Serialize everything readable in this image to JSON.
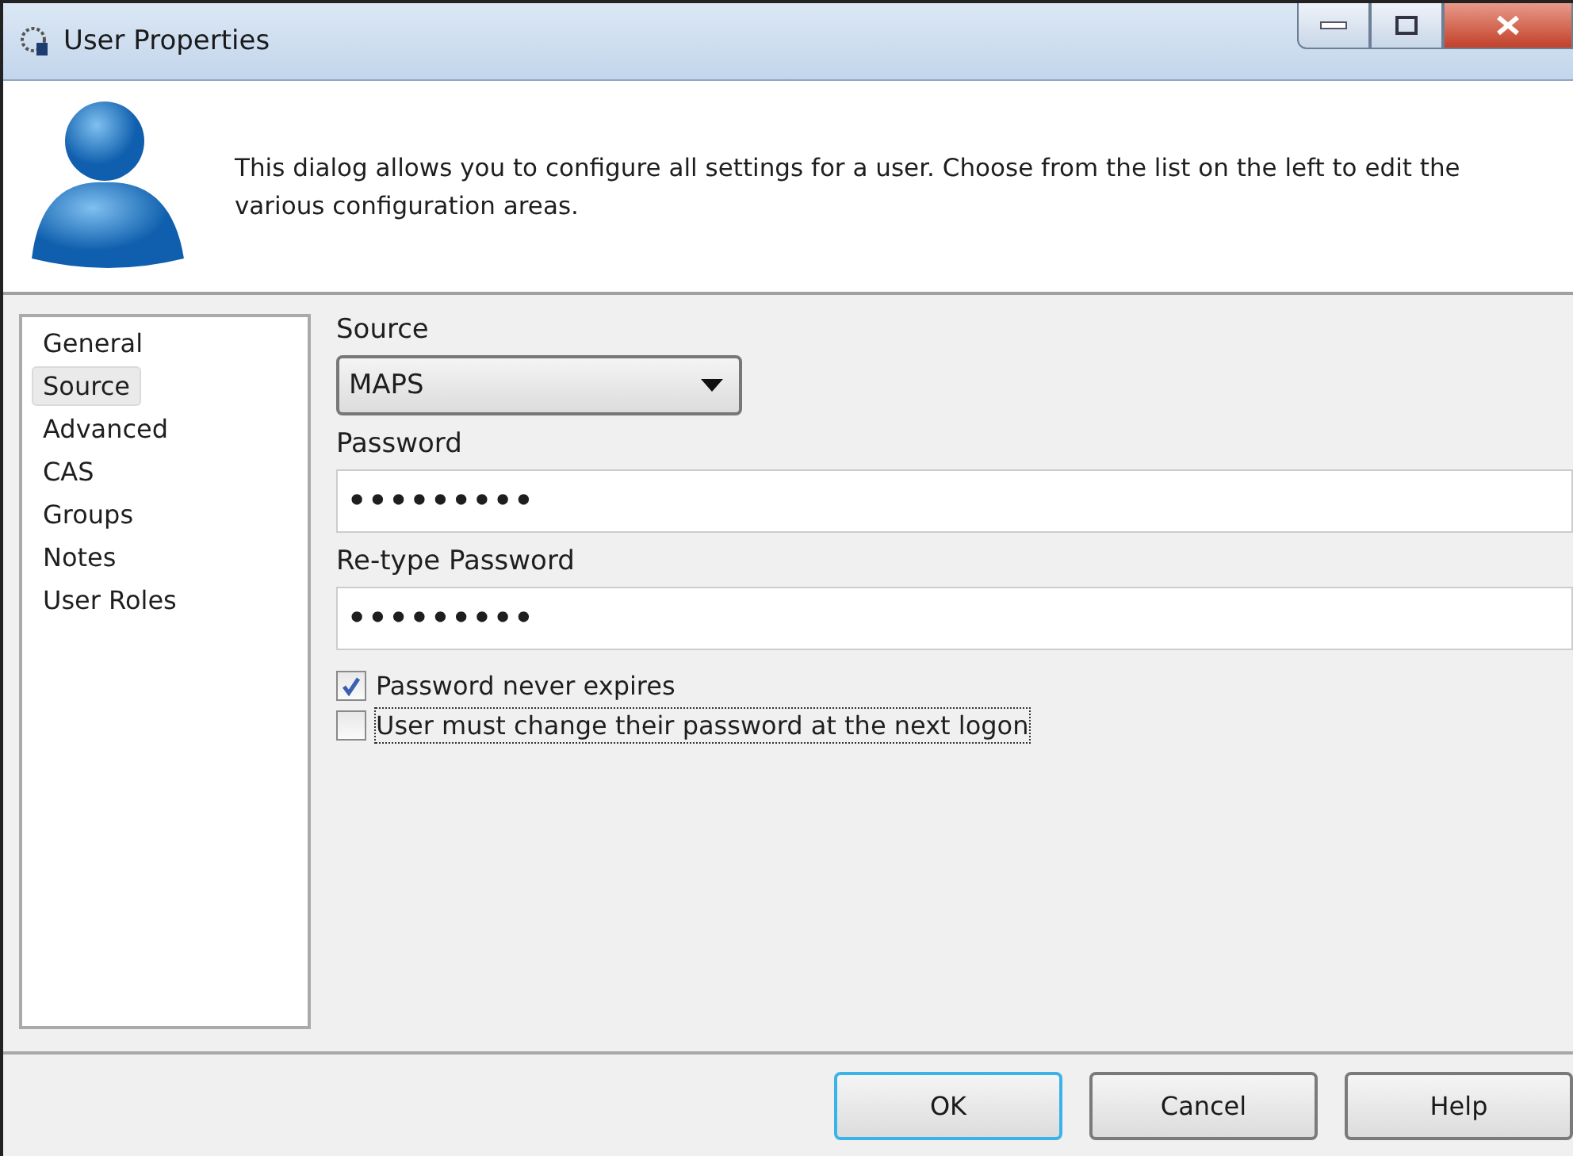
{
  "window": {
    "title": "User Properties"
  },
  "header": {
    "description": "This dialog allows you to configure all settings for a user.  Choose from the list on the left to edit the various configuration areas."
  },
  "sidebar": {
    "items": [
      {
        "label": "General",
        "selected": false
      },
      {
        "label": "Source",
        "selected": true
      },
      {
        "label": "Advanced",
        "selected": false
      },
      {
        "label": "CAS",
        "selected": false
      },
      {
        "label": "Groups",
        "selected": false
      },
      {
        "label": "Notes",
        "selected": false
      },
      {
        "label": "User Roles",
        "selected": false
      }
    ]
  },
  "form": {
    "source": {
      "label": "Source",
      "value": "MAPS"
    },
    "password": {
      "label": "Password",
      "value": "•••••••••"
    },
    "retype_password": {
      "label": "Re-type Password",
      "value": "•••••••••"
    },
    "checkboxes": [
      {
        "label": "Password never expires",
        "checked": true,
        "focused": false
      },
      {
        "label": "User must change their password at the next logon",
        "checked": false,
        "focused": true
      }
    ]
  },
  "buttons": [
    {
      "label": "OK",
      "default": true
    },
    {
      "label": "Cancel",
      "default": false
    },
    {
      "label": "Help",
      "default": false
    }
  ]
}
